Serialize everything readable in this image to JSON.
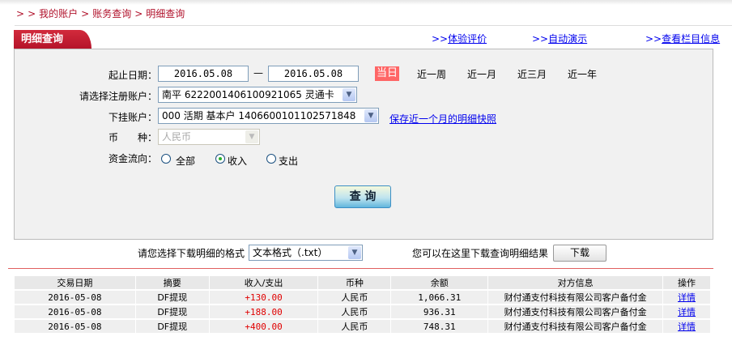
{
  "breadcrumb": [
    ">",
    ">",
    "我的账户",
    ">",
    "账务查询",
    ">",
    "明细查询"
  ],
  "tab_title": "明细查询",
  "top_links": [
    {
      "prefix": ">>",
      "label": "体验评价"
    },
    {
      "prefix": ">>",
      "label": "自动演示"
    },
    {
      "prefix": ">>",
      "label": "查看栏目信息"
    }
  ],
  "form": {
    "date_label": "起止日期：",
    "start_date": "2016.05.08",
    "date_sep": "—",
    "end_date": "2016.05.08",
    "quick_ranges": [
      "当日",
      "近一周",
      "近一月",
      "近三月",
      "近一年"
    ],
    "account_label": "请选择注册账户：",
    "account_value": "南平 6222001406100921065 灵通卡",
    "sub_account_label": "下挂账户：",
    "sub_account_value": "000 活期 基本户 1406600101102571848",
    "snapshot_link": "保存近一个月的明细快照",
    "currency_label": "币　　种：",
    "currency_value": "人民币",
    "flow_label": "资金流向：",
    "flow_options": [
      "全部",
      "收入",
      "支出"
    ],
    "flow_selected": "收入",
    "query_button": "查 询"
  },
  "download": {
    "format_label": "请您选择下载明细的格式",
    "format_value": "文本格式（.txt）",
    "hint": "您可以在这里下载查询明细结果",
    "button": "下载"
  },
  "table": {
    "headers": [
      "交易日期",
      "摘要",
      "收入/支出",
      "币种",
      "余额",
      "对方信息",
      "操作"
    ],
    "rows": [
      [
        "2016-05-08",
        "DF提现",
        "+130.00",
        "人民币",
        "1,066.31",
        "财付通支付科技有限公司客户备付金",
        "详情"
      ],
      [
        "2016-05-08",
        "DF提现",
        "+188.00",
        "人民币",
        "936.31",
        "财付通支付科技有限公司客户备付金",
        "详情"
      ],
      [
        "2016-05-08",
        "DF提现",
        "+400.00",
        "人民币",
        "748.31",
        "财付通支付科技有限公司客户备付金",
        "详情"
      ]
    ]
  },
  "colors": {
    "brand_red": "#b5142a",
    "today_bg": "#ff6666",
    "link": "#0000ee",
    "amount": "#e00000"
  }
}
